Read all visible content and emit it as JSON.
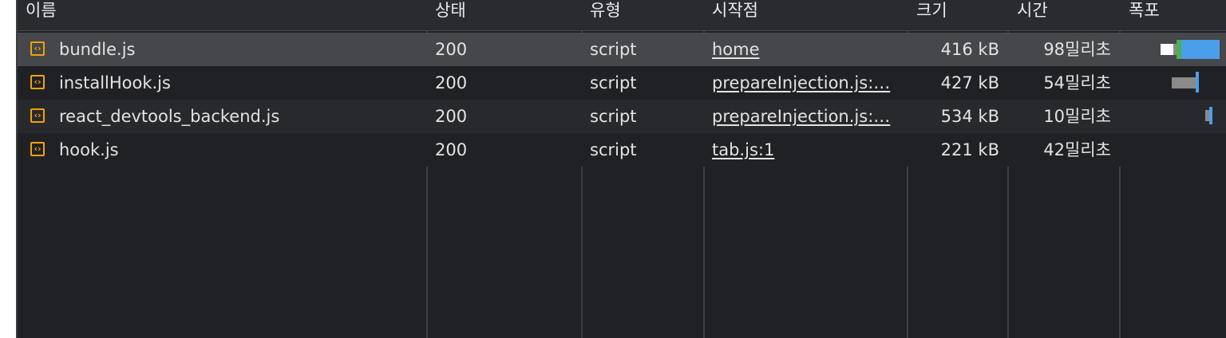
{
  "columns": {
    "name": "이름",
    "status": "상태",
    "type": "유형",
    "initiator": "시작점",
    "size": "크기",
    "time": "시간",
    "waterfall": "폭포"
  },
  "rows": [
    {
      "name": "bundle.js",
      "status": "200",
      "type": "script",
      "initiator": "home",
      "size": "416 kB",
      "time": "98밀리초",
      "icon": "script-file-icon"
    },
    {
      "name": "installHook.js",
      "status": "200",
      "type": "script",
      "initiator": "prepareInjection.js:…",
      "size": "427 kB",
      "time": "54밀리초",
      "icon": "script-file-icon"
    },
    {
      "name": "react_devtools_backend.js",
      "status": "200",
      "type": "script",
      "initiator": "prepareInjection.js:…",
      "size": "534 kB",
      "time": "10밀리초",
      "icon": "script-file-icon"
    },
    {
      "name": "hook.js",
      "status": "200",
      "type": "script",
      "initiator": "tab.js:1",
      "size": "221 kB",
      "time": "42밀리초",
      "icon": "script-file-icon"
    }
  ],
  "colors": {
    "background": "#202124",
    "selected_row": "#45474b",
    "waiting_bar": "#8a8a8a",
    "download_bar": "#4a9eea",
    "connect_bar": "#4caf50",
    "script_icon": "#f0a30a"
  }
}
